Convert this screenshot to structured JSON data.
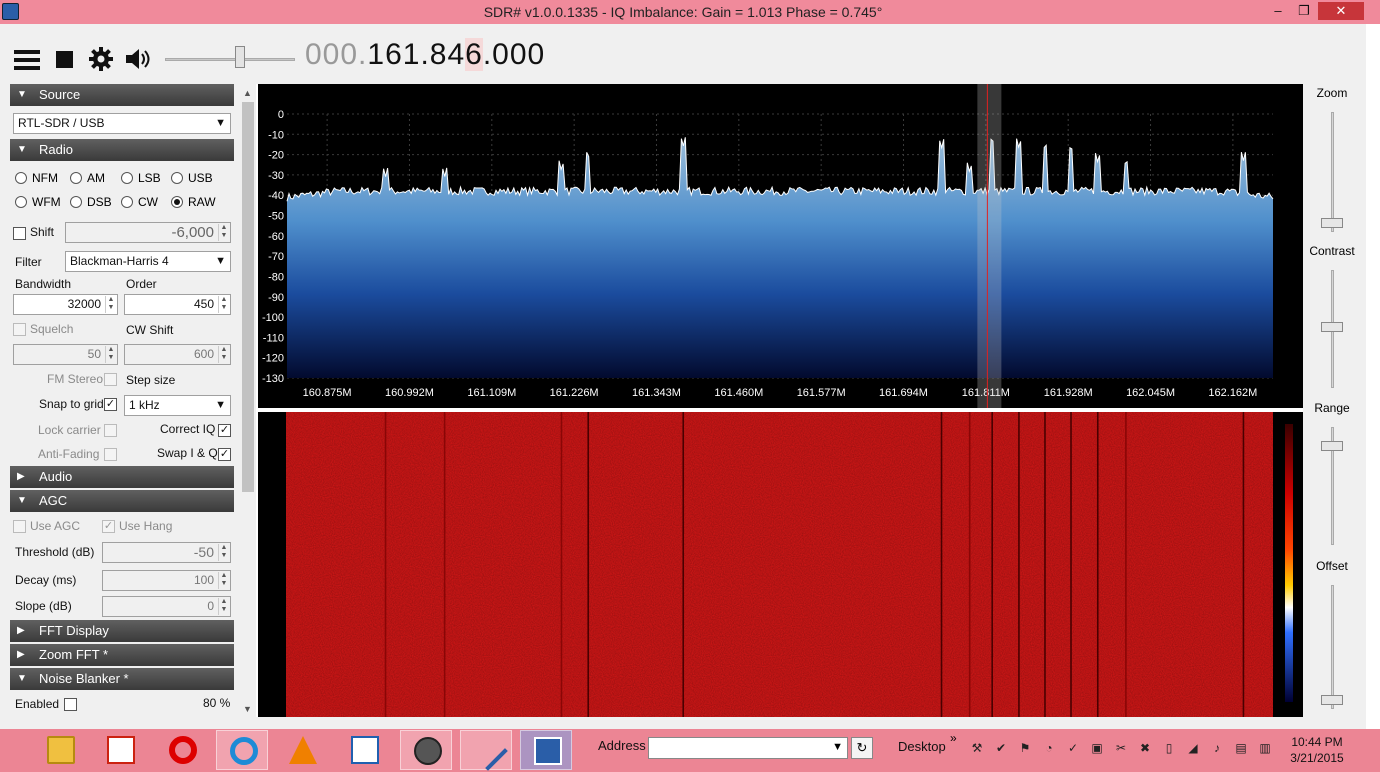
{
  "window": {
    "title": "SDR# v1.0.0.1335 - IQ Imbalance: Gain = 1.013 Phase = 0.745°",
    "minimize": "‒",
    "restore": "❐",
    "close": "✕"
  },
  "toolbar": {
    "freq_dim": "000.",
    "freq_main": "161.84",
    "freq_hl": "6",
    "freq_tail": ".000",
    "volume": 0.58
  },
  "source": {
    "header": "Source",
    "device": "RTL-SDR / USB"
  },
  "radio": {
    "header": "Radio",
    "modes": [
      [
        "NFM",
        "AM",
        "LSB",
        "USB"
      ],
      [
        "WFM",
        "DSB",
        "CW",
        "RAW"
      ]
    ],
    "selected": "RAW",
    "shift_label": "Shift",
    "shift_value": "-6,000",
    "filter_label": "Filter",
    "filter_value": "Blackman-Harris 4",
    "bandwidth_label": "Bandwidth",
    "bandwidth_value": "32000",
    "order_label": "Order",
    "order_value": "450",
    "squelch_label": "Squelch",
    "squelch_value": "50",
    "cwshift_label": "CW Shift",
    "cwshift_value": "600",
    "fmstereo_label": "FM Stereo",
    "stepsize_label": "Step size",
    "snap_label": "Snap to grid",
    "snap_value": "1 kHz",
    "lockcarrier_label": "Lock carrier",
    "correctiq_label": "Correct IQ",
    "antifading_label": "Anti-Fading",
    "swapiq_label": "Swap I & Q"
  },
  "audio": {
    "header": "Audio"
  },
  "agc": {
    "header": "AGC",
    "useagc_label": "Use AGC",
    "usehang_label": "Use Hang",
    "threshold_label": "Threshold (dB)",
    "threshold_value": "-50",
    "decay_label": "Decay (ms)",
    "decay_value": "100",
    "slope_label": "Slope (dB)",
    "slope_value": "0"
  },
  "fft_display": {
    "header": "FFT Display"
  },
  "zoom_fft": {
    "header": "Zoom FFT *"
  },
  "noise_blanker": {
    "header": "Noise Blanker *",
    "enabled_label": "Enabled",
    "percent": "80 %"
  },
  "right": {
    "zoom": "Zoom",
    "contrast": "Contrast",
    "range": "Range",
    "offset": "Offset"
  },
  "spectrum": {
    "y_ticks": [
      "0",
      "-10",
      "-20",
      "-30",
      "-40",
      "-50",
      "-60",
      "-70",
      "-80",
      "-90",
      "-100",
      "-110",
      "-120",
      "-130"
    ],
    "x_ticks": [
      "160.875M",
      "160.992M",
      "161.109M",
      "161.226M",
      "161.343M",
      "161.460M",
      "161.577M",
      "161.694M",
      "161.811M",
      "161.928M",
      "162.045M",
      "162.162M"
    ],
    "noise_floor_db": -38,
    "peaks": [
      {
        "freq_mhz": 160.958,
        "db": -31
      },
      {
        "freq_mhz": 161.042,
        "db": -31
      },
      {
        "freq_mhz": 161.208,
        "db": -28
      },
      {
        "freq_mhz": 161.246,
        "db": -22
      },
      {
        "freq_mhz": 161.381,
        "db": -16
      },
      {
        "freq_mhz": 161.748,
        "db": -17
      },
      {
        "freq_mhz": 161.788,
        "db": -29
      },
      {
        "freq_mhz": 161.82,
        "db": -15
      },
      {
        "freq_mhz": 161.858,
        "db": -17
      },
      {
        "freq_mhz": 161.895,
        "db": -18
      },
      {
        "freq_mhz": 161.932,
        "db": -19
      },
      {
        "freq_mhz": 161.97,
        "db": -24
      },
      {
        "freq_mhz": 162.01,
        "db": -26
      },
      {
        "freq_mhz": 162.177,
        "db": -23
      }
    ],
    "tuned_mhz": 161.816
  },
  "taskbar": {
    "address_label": "Address",
    "desktop_label": "Desktop",
    "chevron": "»",
    "time": "10:44 PM",
    "date": "3/21/2015"
  }
}
